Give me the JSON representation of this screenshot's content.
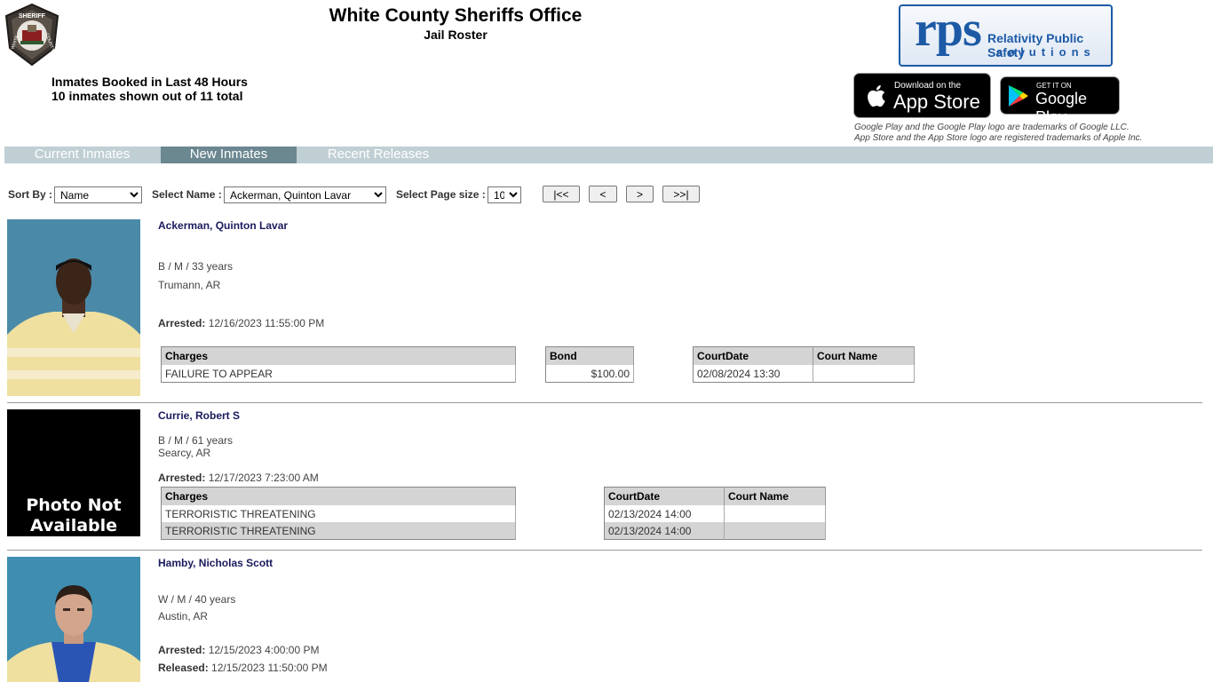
{
  "header": {
    "title": "White County Sheriffs Office",
    "subtitle": "Jail Roster",
    "summary_line1": "Inmates Booked in Last 48 Hours",
    "summary_line2": "10 inmates shown out of 11 total",
    "badge_text_top": "SHERIFF",
    "badge_text_left": "WHITE",
    "badge_text_right": "COUNTY"
  },
  "brand": {
    "rps_logo": "rps",
    "rps_line1": "Relativity Public Safety",
    "rps_line2": "solutions",
    "app_store_small": "Download on the",
    "app_store_big": "App Store",
    "google_play_small": "GET IT ON",
    "google_play_big": "Google Play",
    "trademark_line1": "Google Play and the Google Play logo are trademarks of Google LLC.",
    "trademark_line2": "App Store and the App Store logo are registered trademarks of Apple Inc."
  },
  "tabs": [
    {
      "label": "Current Inmates",
      "active": false
    },
    {
      "label": "New Inmates",
      "active": true
    },
    {
      "label": "Recent Releases",
      "active": false
    }
  ],
  "controls": {
    "sort_label": "Sort By :",
    "sort_value": "Name",
    "name_label": "Select Name :",
    "name_value": "Ackerman, Quinton Lavar",
    "pagesize_label": "Select Page size :",
    "pagesize_value": "10",
    "first": "|<<",
    "prev": "<",
    "next": ">",
    "last": ">>|"
  },
  "labels": {
    "arrested": "Arrested:",
    "released": "Released:",
    "charges": "Charges",
    "bond": "Bond",
    "court_date": "CourtDate",
    "court_name": "Court Name",
    "photo_na_1": "Photo Not",
    "photo_na_2": "Available"
  },
  "inmates": [
    {
      "name": "Ackerman, Quinton Lavar",
      "demo": "B / M / 33 years",
      "city": "Trumann, AR",
      "arrested": "12/16/2023 11:55:00 PM",
      "charges": [
        "FAILURE TO APPEAR"
      ],
      "bonds": [
        "$100.00"
      ],
      "courts": [
        {
          "date": "02/08/2024 13:30",
          "name": ""
        }
      ]
    },
    {
      "name": "Currie, Robert S",
      "demo": "B / M / 61 years",
      "city": "Searcy, AR",
      "arrested": "12/17/2023 7:23:00 AM",
      "charges": [
        "TERRORISTIC THREATENING",
        "TERRORISTIC THREATENING"
      ],
      "courts": [
        {
          "date": "02/13/2024 14:00",
          "name": ""
        },
        {
          "date": "02/13/2024 14:00",
          "name": ""
        }
      ]
    },
    {
      "name": "Hamby, Nicholas Scott",
      "demo": "W / M / 40 years",
      "city": "Austin, AR",
      "arrested": "12/15/2023 4:00:00 PM",
      "released": "12/15/2023 11:50:00 PM"
    }
  ],
  "colors": {
    "tabbar": "#c0cfd4",
    "tab_active": "#6b8790",
    "name_color": "#1a1a5e",
    "rps_blue": "#1c5aa6"
  }
}
